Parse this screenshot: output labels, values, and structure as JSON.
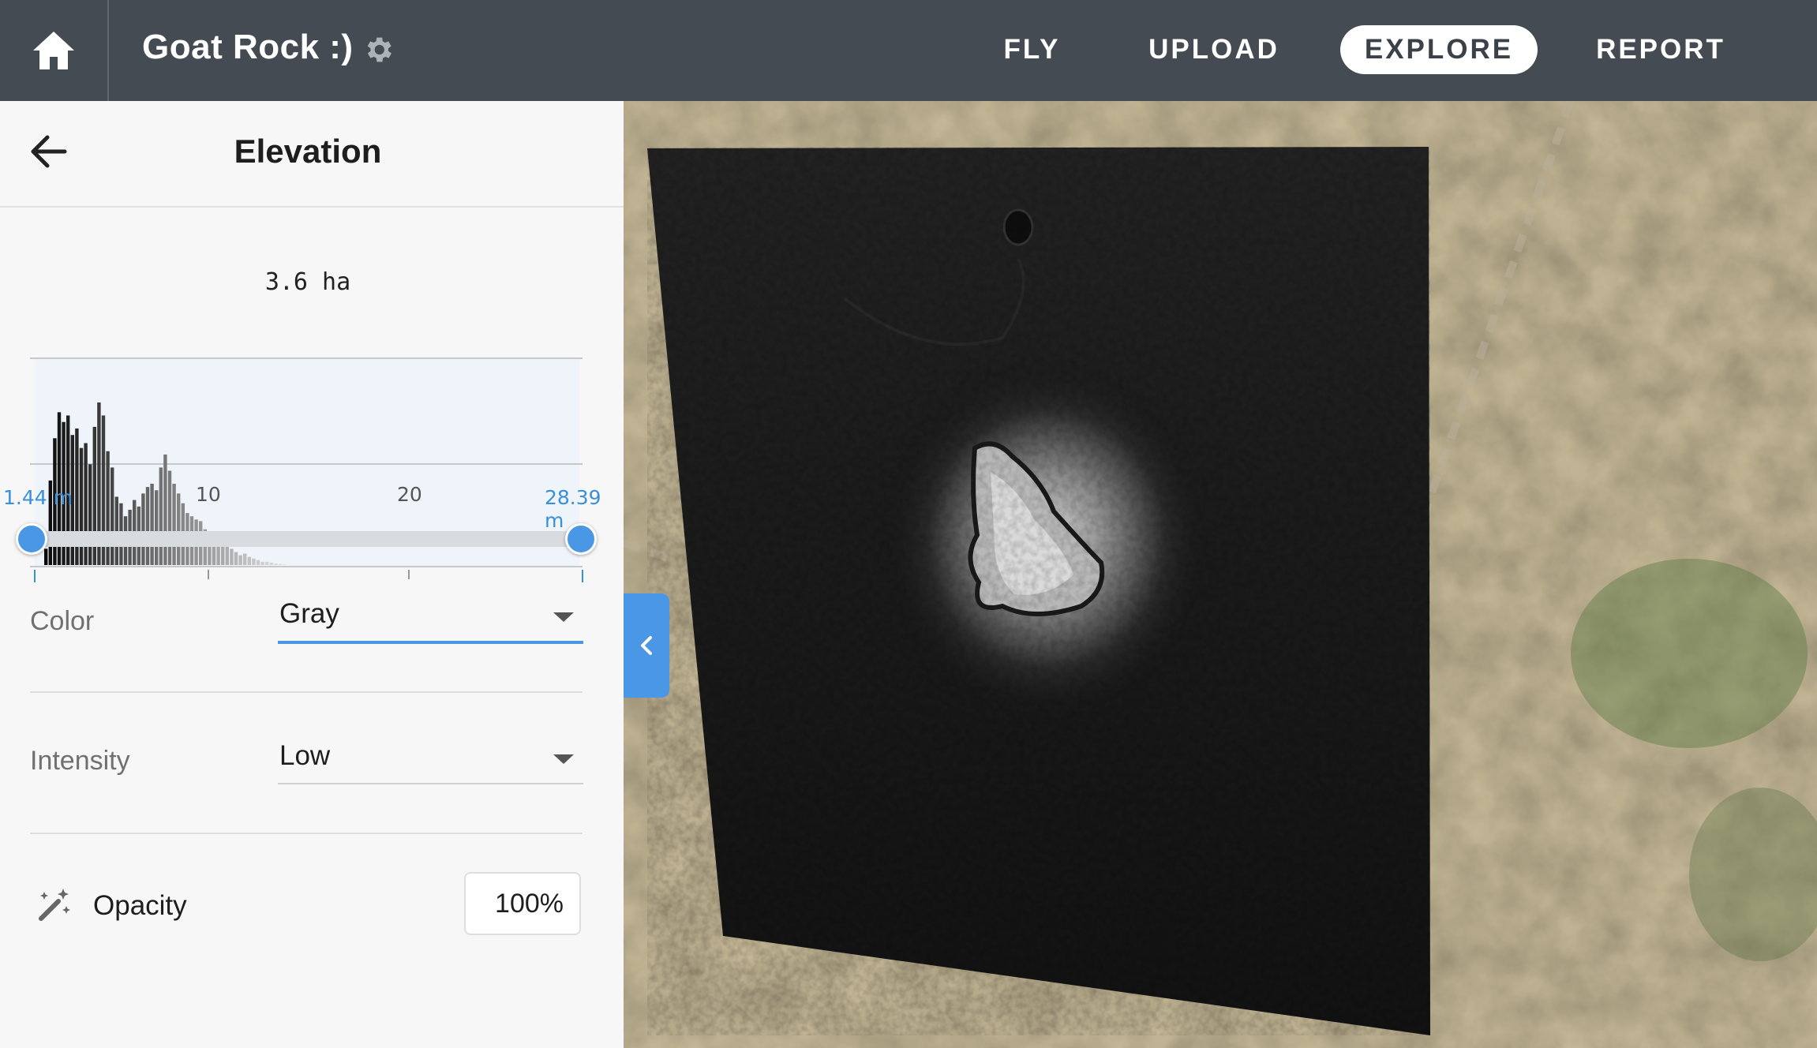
{
  "topbar": {
    "project_title": "Goat Rock :)",
    "nav": [
      {
        "label": "FLY",
        "active": false
      },
      {
        "label": "UPLOAD",
        "active": false
      },
      {
        "label": "EXPLORE",
        "active": true
      },
      {
        "label": "REPORT",
        "active": false
      }
    ]
  },
  "panel": {
    "title": "Elevation",
    "histogram": {
      "area_label": "3.6 ha",
      "tick_labels": [
        "10",
        "20"
      ],
      "range_min_label": "1.44 m",
      "range_max_label": "28.39 m"
    },
    "range_slider": {
      "min": 1.44,
      "max": 28.39,
      "low": 1.44,
      "high": 28.39
    },
    "color": {
      "label": "Color",
      "value": "Gray"
    },
    "intensity": {
      "label": "Intensity",
      "value": "Low"
    },
    "opacity": {
      "label": "Opacity",
      "value": "100%"
    }
  },
  "colors": {
    "topbar_bg": "#454b52",
    "accent": "#4a97e6",
    "panel_bg": "#f7f7f7"
  },
  "icons": [
    "home-icon",
    "gear-icon",
    "arrow-left-icon",
    "chevron-down-icon",
    "magic-wand-icon",
    "chevron-left-icon"
  ]
}
